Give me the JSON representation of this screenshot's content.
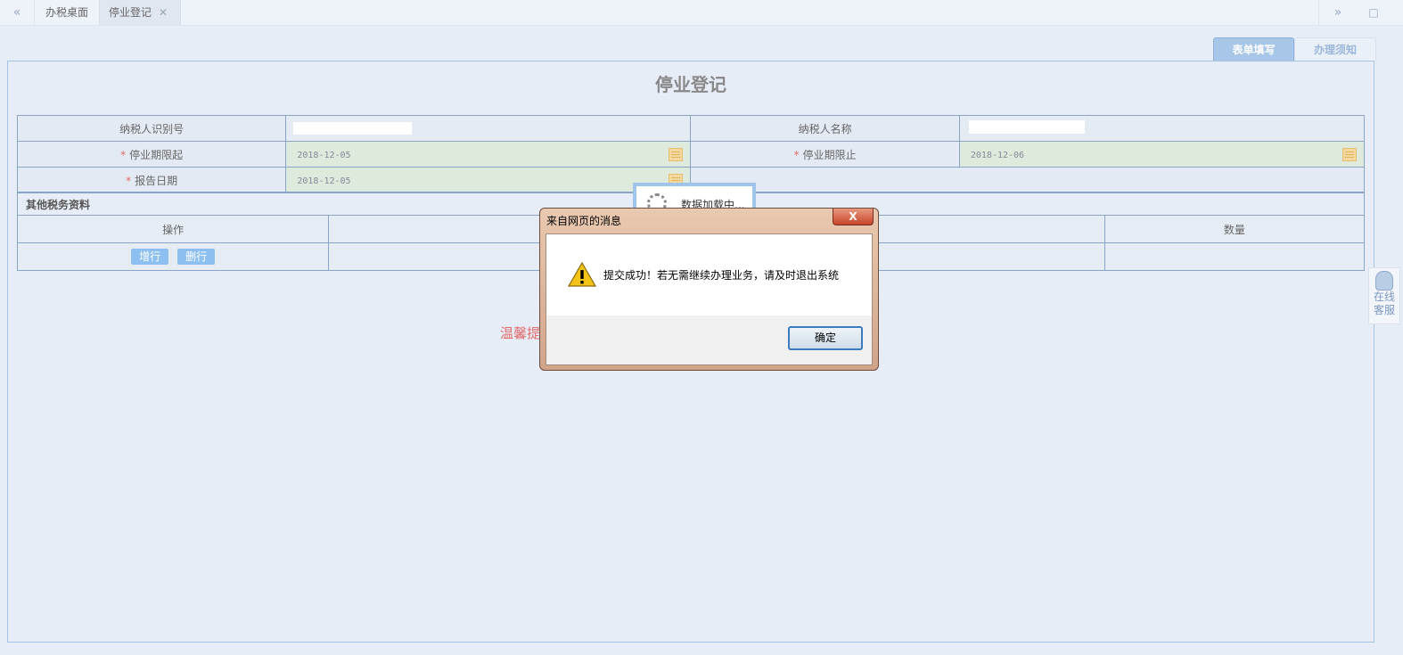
{
  "tabs": {
    "home": "办税桌面",
    "active": "停业登记",
    "close_glyph": "✕",
    "prev_glyph": "«",
    "next_glyph": "»",
    "max_glyph": "□"
  },
  "side_tabs": {
    "fill": "表单填写",
    "notice": "办理须知"
  },
  "page_title": "停业登记",
  "form": {
    "taxpayer_id_label": "纳税人识别号",
    "taxpayer_name_label": "纳税人名称",
    "start_label": "停业期限起",
    "start_value": "2018-12-05",
    "end_label": "停业期限止",
    "end_value": "2018-12-06",
    "report_label": "报告日期",
    "report_value": "2018-12-05",
    "required_mark": "*"
  },
  "other_section": {
    "title": "其他税务资料",
    "columns": [
      "操作",
      "数量"
    ],
    "add_row": "增行",
    "delete_row": "删行"
  },
  "tip_text": "温馨提",
  "loading_text": "数据加载中...",
  "dialog": {
    "title": "来自网页的消息",
    "close_glyph": "X",
    "message": "提交成功！若无需继续办理业务，请及时退出系统",
    "ok_label": "确定"
  },
  "service": {
    "line1": "在线",
    "line2": "客服"
  }
}
